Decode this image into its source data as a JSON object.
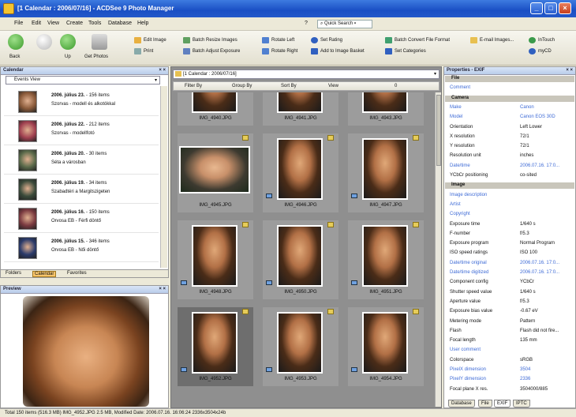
{
  "window": {
    "title": "[1 Calendar : 2006/07/16] - ACDSee 9 Photo Manager",
    "controls": {
      "min": "_",
      "max": "□",
      "close": "×"
    }
  },
  "menu": [
    "File",
    "Edit",
    "View",
    "Create",
    "Tools",
    "Database",
    "Help",
    "?"
  ],
  "quick_search": "Quick Search",
  "toolbar": {
    "back": "Back",
    "forward": "",
    "up": "Up",
    "get_photos": "Get Photos",
    "edit_image": "Edit Image",
    "print": "Print",
    "batch_resize": "Batch Resize Images",
    "batch_adjust": "Batch Adjust Exposure",
    "rotate_left": "Rotate Left",
    "rotate_right": "Rotate Right",
    "set_rating": "Set Rating",
    "add_to_basket": "Add to Image Basket",
    "batch_convert": "Batch Convert File Format",
    "email": "E-mail Images...",
    "set_categories": "Set Categories",
    "intouch": "InTouch",
    "mycd": "myCD"
  },
  "calendar_panel": {
    "title": "Calendar",
    "close": "× ×",
    "events_view": "Events View",
    "events": [
      {
        "date": "2006. július 23.",
        "count": "- 156 items",
        "desc": "Szorvas - modell és alkotókkal"
      },
      {
        "date": "2006. július 22.",
        "count": "- 212 items",
        "desc": "Szorvas - modellfotó"
      },
      {
        "date": "2006. július 20.",
        "count": "- 30 items",
        "desc": "Séta a városban"
      },
      {
        "date": "2006. július 19.",
        "count": "- 34 items",
        "desc": "Szabadtéri a Margitszigeten"
      },
      {
        "date": "2006. július 16.",
        "count": "- 150 items",
        "desc": "Orvosa EB - Férfi döntő"
      },
      {
        "date": "2006. július 15.",
        "count": "- 346 items",
        "desc": "Orvosa EB - Női döntő"
      }
    ],
    "tabs": [
      "Folders",
      "Calendar",
      "Favorites"
    ],
    "active_tab": "Calendar"
  },
  "preview_panel": {
    "title": "Preview",
    "close": "× ×"
  },
  "browser": {
    "path": "[1 Calendar : 2006/07/16]",
    "filter_by": "Filter By",
    "group_by": "Group By",
    "sort_by": "Sort By",
    "view": "View",
    "zoom_value": "0",
    "files": [
      "IMG_4940.JPG",
      "IMG_4941.JPG",
      "IMG_4943.JPG",
      "IMG_4945.JPG",
      "IMG_4946.JPG",
      "IMG_4947.JPG",
      "IMG_4948.JPG",
      "IMG_4950.JPG",
      "IMG_4951.JPG",
      "IMG_4952.JPG",
      "IMG_4953.JPG",
      "IMG_4954.JPG"
    ],
    "selected_index": 9
  },
  "properties_panel": {
    "title": "Properties - EXIF",
    "close": "× ×",
    "rows": [
      {
        "type": "sec",
        "k": "File"
      },
      {
        "type": "blue",
        "k": "Comment",
        "v": ""
      },
      {
        "type": "sec",
        "k": "Camera"
      },
      {
        "type": "blue",
        "k": "Make",
        "v": "Canon"
      },
      {
        "type": "blue",
        "k": "Model",
        "v": "Canon EOS 30D"
      },
      {
        "type": "",
        "k": "Orientation",
        "v": "Left Lower"
      },
      {
        "type": "",
        "k": "X resolution",
        "v": "72/1"
      },
      {
        "type": "",
        "k": "Y resolution",
        "v": "72/1"
      },
      {
        "type": "",
        "k": "Resolution unit",
        "v": "inches"
      },
      {
        "type": "blue",
        "k": "Date/time",
        "v": "2006.07.16. 17:0..."
      },
      {
        "type": "",
        "k": "YCbCr positioning",
        "v": "co-sited"
      },
      {
        "type": "sec",
        "k": "Image"
      },
      {
        "type": "blue",
        "k": "Image description",
        "v": ""
      },
      {
        "type": "blue",
        "k": "Artist",
        "v": ""
      },
      {
        "type": "blue",
        "k": "Copyright",
        "v": ""
      },
      {
        "type": "",
        "k": "Exposure time",
        "v": "1/640 s"
      },
      {
        "type": "",
        "k": "F-number",
        "v": "f/5.3"
      },
      {
        "type": "",
        "k": "Exposure program",
        "v": "Normal Program"
      },
      {
        "type": "",
        "k": "ISO speed ratings",
        "v": "ISO 100"
      },
      {
        "type": "blue",
        "k": "Date/time original",
        "v": "2006.07.16. 17:0..."
      },
      {
        "type": "blue",
        "k": "Date/time digitized",
        "v": "2006.07.16. 17:0..."
      },
      {
        "type": "",
        "k": "Component config",
        "v": "YCbCr"
      },
      {
        "type": "",
        "k": "Shutter speed value",
        "v": "1/640 s"
      },
      {
        "type": "",
        "k": "Aperture value",
        "v": "f/5.3"
      },
      {
        "type": "",
        "k": "Exposure bias value",
        "v": "-0.67 eV"
      },
      {
        "type": "",
        "k": "Metering mode",
        "v": "Pattern"
      },
      {
        "type": "",
        "k": "Flash",
        "v": "Flash did not fire..."
      },
      {
        "type": "",
        "k": "Focal length",
        "v": "135 mm"
      },
      {
        "type": "blue",
        "k": "User comment",
        "v": ""
      },
      {
        "type": "",
        "k": "Colorspace",
        "v": "sRGB"
      },
      {
        "type": "blue",
        "k": "PixelX dimension",
        "v": "3504"
      },
      {
        "type": "blue",
        "k": "PixelY dimension",
        "v": "2336"
      },
      {
        "type": "",
        "k": "Focal plane X res.",
        "v": "3504000/885"
      }
    ],
    "tabs": [
      "Database",
      "File",
      "EXIF",
      "IPTC"
    ],
    "active_tab": "EXIF"
  },
  "status": {
    "text": "Total 150 items (516.3 MB)   IMG_4952.JPG   2.5 MB, Modified Date: 2006.07.16. 16:06:24   2336x3504x24b"
  },
  "colors": {
    "titlebar": "#1a4fc4",
    "accent_tab": "#f7c56b",
    "link_blue": "#3d6ad6",
    "browser_bg": "#8f8f8f"
  }
}
